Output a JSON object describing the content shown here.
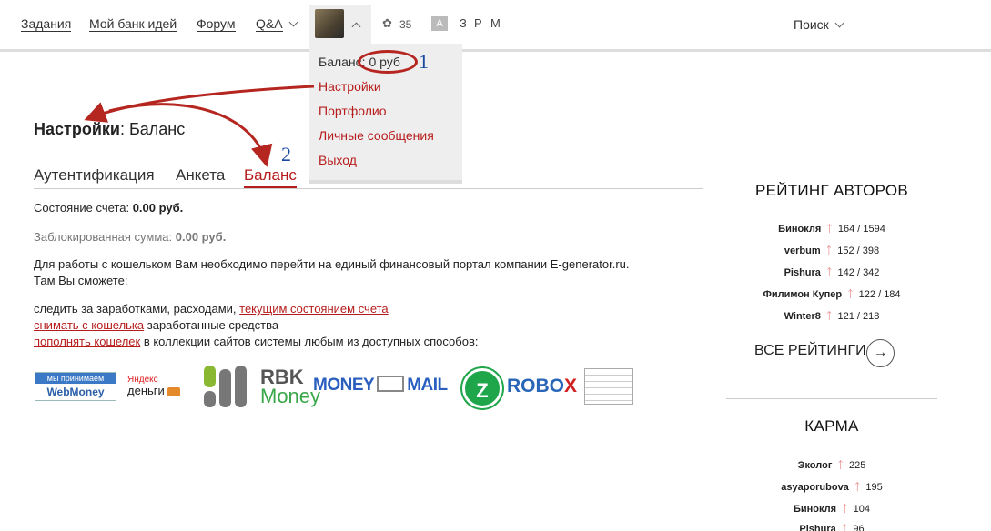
{
  "nav": {
    "items": [
      "Задания",
      "Мой банк идей",
      "Форум"
    ],
    "qa": "Q&A",
    "count": "35",
    "a": "A",
    "letters": [
      "З",
      "Р",
      "М"
    ],
    "search": "Поиск"
  },
  "dropdown": {
    "balance_label": "Баланс:",
    "balance_value": "0 руб",
    "items": [
      "Настройки",
      "Портфолио",
      "Личные сообщения",
      "Выход"
    ]
  },
  "annotations": {
    "one": "1",
    "two": "2"
  },
  "page": {
    "title_bold": "Настройки",
    "title_rest": ": Баланс",
    "tabs": [
      "Аутентификация",
      "Анкета",
      "Баланс"
    ],
    "account_label": "Состояние счета:",
    "account_value": "0.00 руб.",
    "blocked_label": "Заблокированная сумма:",
    "blocked_value": "0.00 руб.",
    "info_line1": "Для работы с кошельком Вам необходимо перейти на единый финансовый портал компании E-generator.ru.",
    "info_line2": "Там Вы сможете:",
    "l1_text": "следить за заработками, расходами, ",
    "l1_link": "текущим состоянием счета",
    "l2_link": "снимать с кошелька",
    "l2_text": " заработанные средства",
    "l3_link": "пополнять кошелек",
    "l3_text": " в коллекции сайтов системы любым из доступных способов:"
  },
  "logos": {
    "wm_top": "мы принимаем",
    "wm_main": "WebMoney",
    "ya_top": "Яндекс",
    "ya_main": "деньги",
    "rbk_top": "RBK",
    "rbk_bottom": "Money",
    "mm_left": "MONEY",
    "mm_right": "MAIL",
    "zp": "Z",
    "robo": "ROBO",
    "robo_x": "X"
  },
  "sidebar": {
    "rating_title": "РЕЙТИНГ АВТОРОВ",
    "authors": [
      {
        "name": "Бинокля",
        "score": "164 / 1594"
      },
      {
        "name": "verbum",
        "score": "152 / 398"
      },
      {
        "name": "Pishura",
        "score": "142 / 342"
      },
      {
        "name": "Филимон Купер",
        "score": "122 / 184"
      },
      {
        "name": "Winter8",
        "score": "121 / 218"
      }
    ],
    "all_ratings": "ВСЕ РЕЙТИНГИ",
    "karma_title": "КАРМА",
    "karma": [
      {
        "name": "Эколог",
        "score": "225"
      },
      {
        "name": "asyaporubova",
        "score": "195"
      },
      {
        "name": "Бинокля",
        "score": "104"
      },
      {
        "name": "Pishura",
        "score": "96"
      }
    ]
  }
}
